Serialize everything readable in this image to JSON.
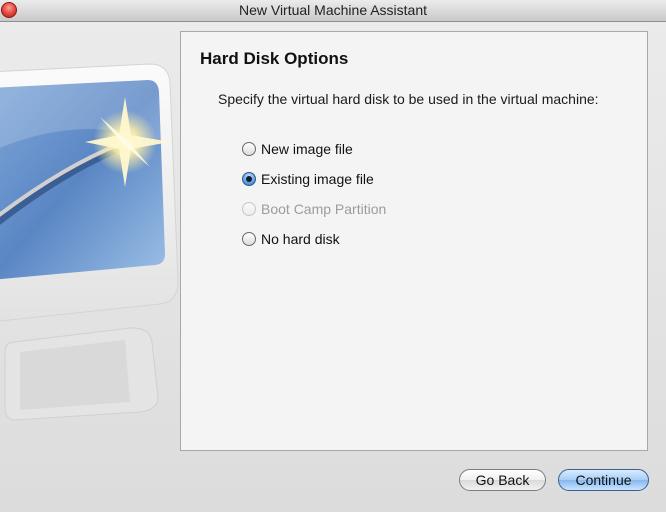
{
  "window": {
    "title": "New Virtual Machine Assistant"
  },
  "panel": {
    "heading": "Hard Disk Options",
    "instruction": "Specify the virtual hard disk to be used in the virtual machine:",
    "options": [
      {
        "label": "New image file",
        "selected": false,
        "enabled": true
      },
      {
        "label": "Existing image file",
        "selected": true,
        "enabled": true
      },
      {
        "label": "Boot Camp Partition",
        "selected": false,
        "enabled": false
      },
      {
        "label": "No hard disk",
        "selected": false,
        "enabled": true
      }
    ]
  },
  "buttons": {
    "back": "Go Back",
    "continue": "Continue"
  }
}
